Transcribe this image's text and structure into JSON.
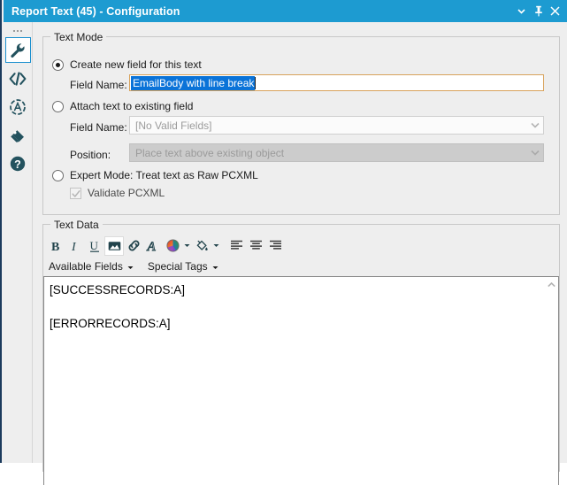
{
  "window": {
    "title": "Report Text (45) - Configuration",
    "titlebar_color": "#1d9bd1",
    "buttons": [
      {
        "name": "dropdown-button",
        "icon": "chevron-down-icon"
      },
      {
        "name": "pin-button",
        "icon": "pin-icon"
      },
      {
        "name": "close-button",
        "icon": "close-icon"
      }
    ]
  },
  "sidebar": {
    "items": [
      {
        "name": "configuration",
        "icon": "wrench-icon",
        "selected": true
      },
      {
        "name": "xml-view",
        "icon": "code-icon",
        "selected": false
      },
      {
        "name": "annotation",
        "icon": "circled-a-icon",
        "selected": false
      },
      {
        "name": "tag",
        "icon": "tag-icon",
        "selected": false
      },
      {
        "name": "help",
        "icon": "question-mark-icon",
        "selected": false
      }
    ]
  },
  "text_mode": {
    "legend": "Text Mode",
    "option_create": {
      "label": "Create new field for this text",
      "selected": true,
      "field_name_label": "Field Name:",
      "field_name_value": "EmailBody with line break"
    },
    "option_attach": {
      "label": "Attach text to existing field",
      "selected": false,
      "field_name_label": "Field Name:",
      "field_name_value": "[No Valid Fields]",
      "position_label": "Position:",
      "position_value": "Place text above existing object"
    },
    "option_expert": {
      "label": "Expert Mode: Treat text as Raw PCXML",
      "selected": false,
      "validate_label": "Validate PCXML",
      "validate_checked": true
    }
  },
  "text_data": {
    "legend": "Text Data",
    "toolbar": [
      {
        "name": "bold-button",
        "icon": "bold-icon",
        "label": "B",
        "active": false
      },
      {
        "name": "italic-button",
        "icon": "italic-icon",
        "label": "I",
        "active": false
      },
      {
        "name": "underline-button",
        "icon": "underline-icon",
        "label": "U",
        "active": false
      },
      {
        "name": "insert-image-button",
        "icon": "image-icon",
        "active": true
      },
      {
        "name": "insert-link-button",
        "icon": "link-icon",
        "active": false
      },
      {
        "name": "font-button",
        "icon": "font-a-icon",
        "active": false
      },
      {
        "name": "text-color-button",
        "icon": "color-wheel-icon",
        "active": false
      },
      {
        "name": "fill-color-button",
        "icon": "paint-bucket-icon",
        "active": false
      },
      {
        "name": "align-left-button",
        "icon": "align-left-icon",
        "active": false
      },
      {
        "name": "align-center-button",
        "icon": "align-center-icon",
        "active": false
      },
      {
        "name": "align-right-button",
        "icon": "align-right-icon",
        "active": false
      }
    ],
    "menus": [
      {
        "name": "available-fields-menu",
        "label": "Available Fields"
      },
      {
        "name": "special-tags-menu",
        "label": "Special Tags"
      }
    ],
    "editor": {
      "lines": [
        "[SUCCESSRECORDS:A]",
        "",
        "[ERRORRECORDS:A]"
      ]
    },
    "scrollbar": {
      "name": "editor-vertical-scrollbar",
      "up_icon": "chevron-up-icon"
    }
  }
}
